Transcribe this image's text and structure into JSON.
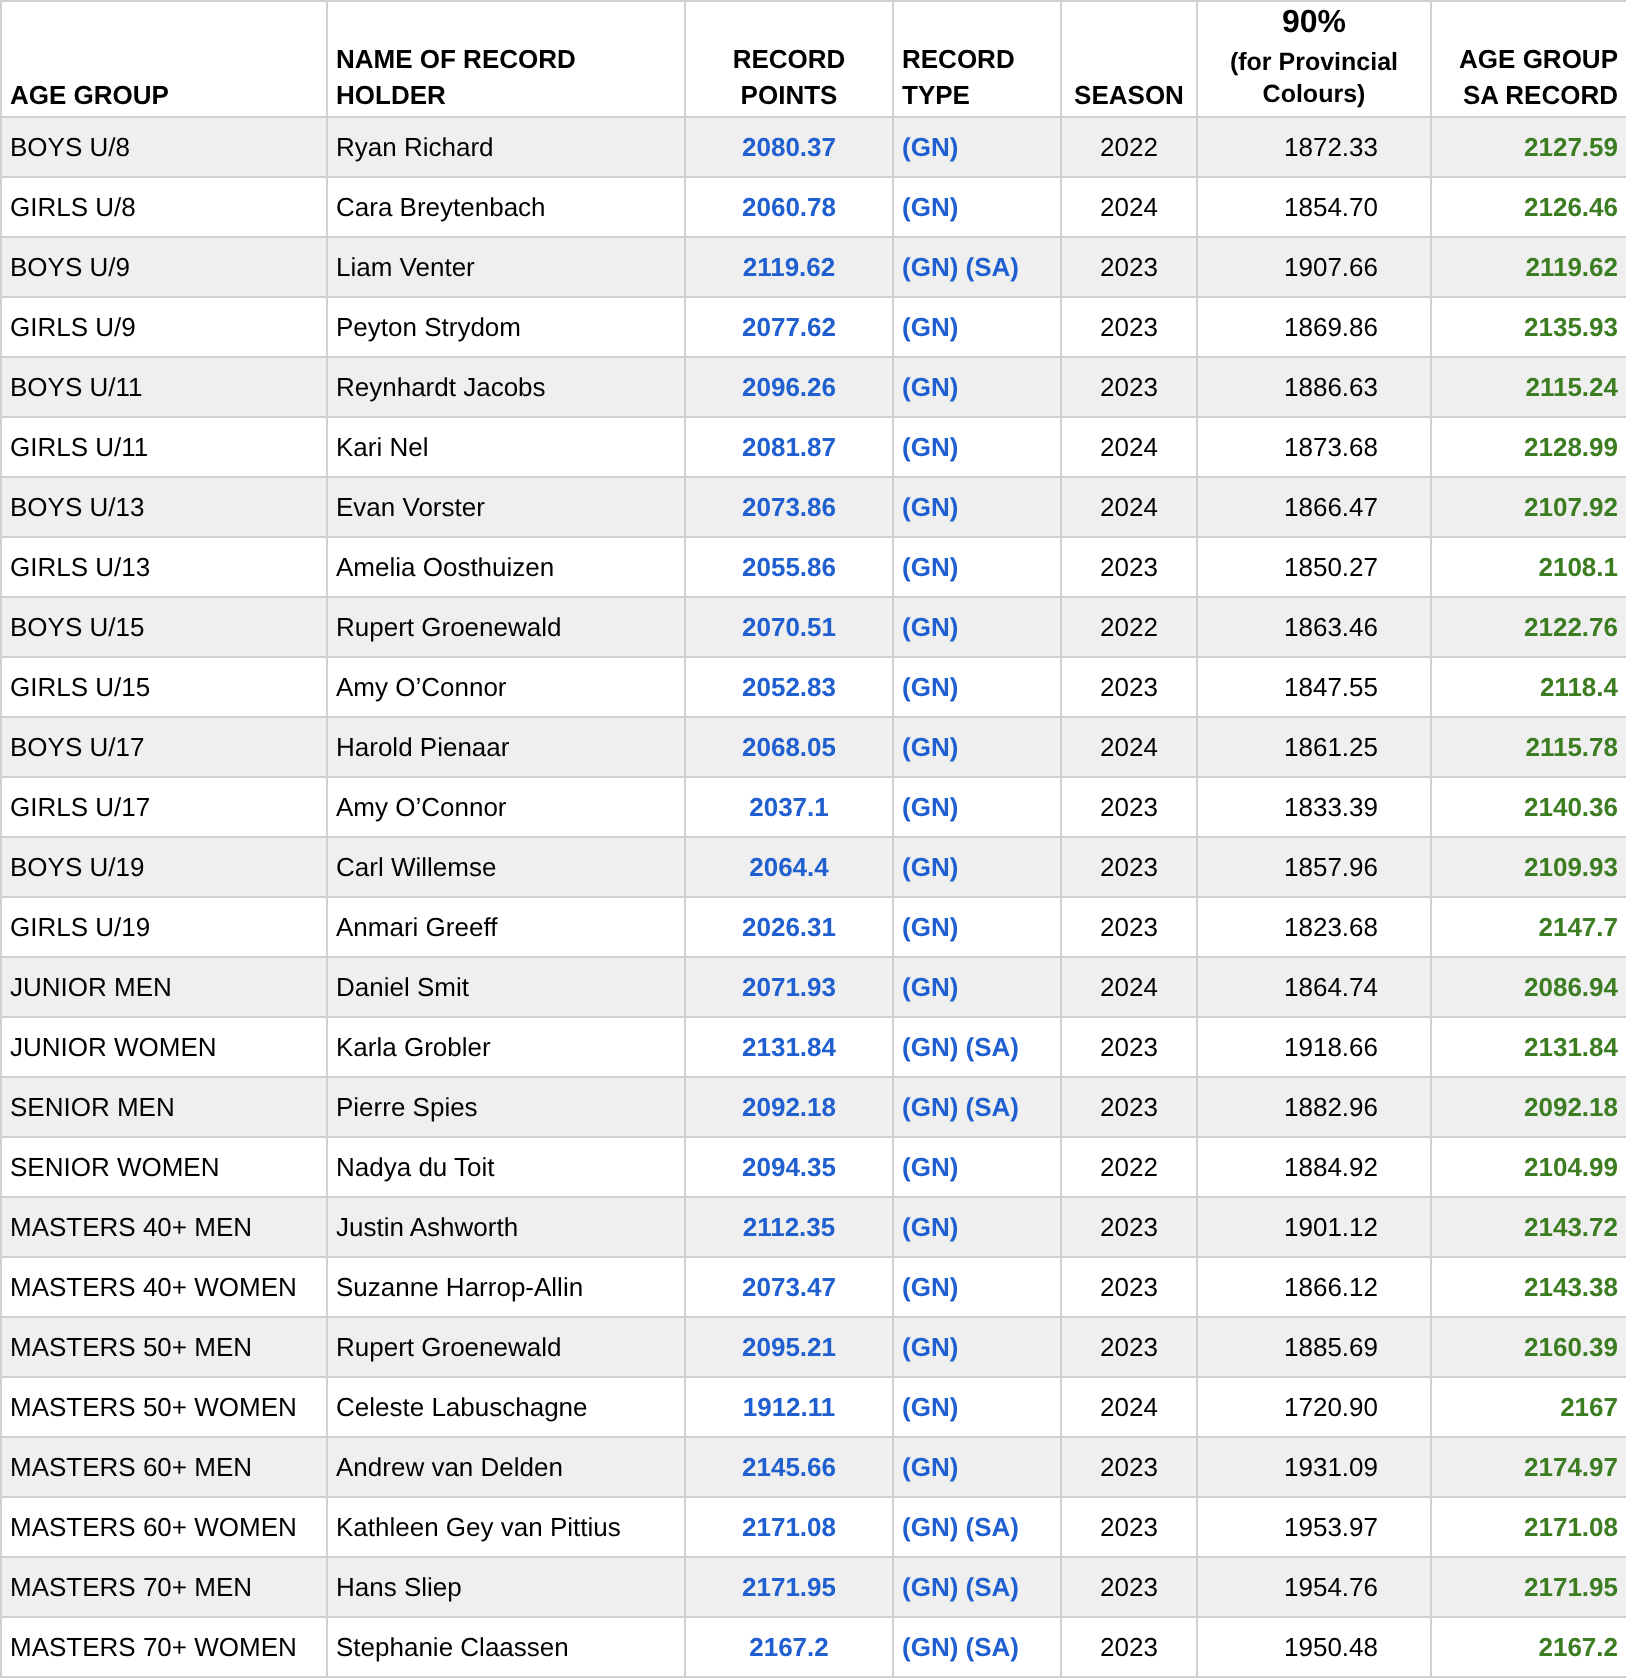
{
  "table": {
    "columns": [
      {
        "label": "AGE GROUP"
      },
      {
        "label": "NAME OF RECORD HOLDER"
      },
      {
        "label": "RECORD POINTS"
      },
      {
        "label": "RECORD TYPE"
      },
      {
        "label": "SEASON"
      },
      {
        "label": "90%",
        "sublabel": "(for Provincial Colours)"
      },
      {
        "label": "AGE GROUP SA RECORD"
      }
    ],
    "rows": [
      [
        "BOYS U/8",
        "Ryan Richard",
        "2080.37",
        "(GN)",
        "2022",
        "1872.33",
        "2127.59"
      ],
      [
        "GIRLS U/8",
        "Cara Breytenbach",
        "2060.78",
        "(GN)",
        "2024",
        "1854.70",
        "2126.46"
      ],
      [
        "BOYS U/9",
        "Liam Venter",
        "2119.62",
        "(GN) (SA)",
        "2023",
        "1907.66",
        "2119.62"
      ],
      [
        "GIRLS U/9",
        "Peyton Strydom",
        "2077.62",
        "(GN)",
        "2023",
        "1869.86",
        "2135.93"
      ],
      [
        "BOYS U/11",
        "Reynhardt Jacobs",
        "2096.26",
        "(GN)",
        "2023",
        "1886.63",
        "2115.24"
      ],
      [
        "GIRLS U/11",
        "Kari Nel",
        "2081.87",
        "(GN)",
        "2024",
        "1873.68",
        "2128.99"
      ],
      [
        "BOYS U/13",
        "Evan Vorster",
        "2073.86",
        "(GN)",
        "2024",
        "1866.47",
        "2107.92"
      ],
      [
        "GIRLS U/13",
        "Amelia Oosthuizen",
        "2055.86",
        "(GN)",
        "2023",
        "1850.27",
        "2108.1"
      ],
      [
        "BOYS U/15",
        "Rupert Groenewald",
        "2070.51",
        "(GN)",
        "2022",
        "1863.46",
        "2122.76"
      ],
      [
        "GIRLS U/15",
        "Amy O’Connor",
        "2052.83",
        "(GN)",
        "2023",
        "1847.55",
        "2118.4"
      ],
      [
        "BOYS U/17",
        "Harold Pienaar",
        "2068.05",
        "(GN)",
        "2024",
        "1861.25",
        "2115.78"
      ],
      [
        "GIRLS U/17",
        "Amy O’Connor",
        "2037.1",
        "(GN)",
        "2023",
        "1833.39",
        "2140.36"
      ],
      [
        "BOYS U/19",
        "Carl Willemse",
        "2064.4",
        "(GN)",
        "2023",
        "1857.96",
        "2109.93"
      ],
      [
        "GIRLS U/19",
        "Anmari Greeff",
        "2026.31",
        "(GN)",
        "2023",
        "1823.68",
        "2147.7"
      ],
      [
        "JUNIOR MEN",
        "Daniel Smit",
        "2071.93",
        "(GN)",
        "2024",
        "1864.74",
        "2086.94"
      ],
      [
        "JUNIOR WOMEN",
        "Karla Grobler",
        "2131.84",
        "(GN) (SA)",
        "2023",
        "1918.66",
        "2131.84"
      ],
      [
        "SENIOR MEN",
        "Pierre Spies",
        "2092.18",
        "(GN) (SA)",
        "2023",
        "1882.96",
        "2092.18"
      ],
      [
        "SENIOR WOMEN",
        "Nadya du Toit",
        "2094.35",
        "(GN)",
        "2022",
        "1884.92",
        "2104.99"
      ],
      [
        "MASTERS 40+ MEN",
        "Justin Ashworth",
        "2112.35",
        "(GN)",
        "2023",
        "1901.12",
        "2143.72"
      ],
      [
        "MASTERS 40+ WOMEN",
        "Suzanne Harrop-Allin",
        "2073.47",
        "(GN)",
        "2023",
        "1866.12",
        "2143.38"
      ],
      [
        "MASTERS 50+ MEN",
        "Rupert Groenewald",
        "2095.21",
        "(GN)",
        "2023",
        "1885.69",
        "2160.39"
      ],
      [
        "MASTERS 50+ WOMEN",
        "Celeste Labuschagne",
        "1912.11",
        "(GN)",
        "2024",
        "1720.90",
        "2167"
      ],
      [
        "MASTERS 60+ MEN",
        "Andrew van Delden",
        "2145.66",
        "(GN)",
        "2023",
        "1931.09",
        "2174.97"
      ],
      [
        "MASTERS 60+ WOMEN",
        "Kathleen Gey van Pittius",
        "2171.08",
        "(GN) (SA)",
        "2023",
        "1953.97",
        "2171.08"
      ],
      [
        "MASTERS 70+ MEN",
        "Hans Sliep",
        "2171.95",
        "(GN) (SA)",
        "2023",
        "1954.76",
        "2171.95"
      ],
      [
        "MASTERS 70+ WOMEN",
        "Stephanie Claassen",
        "2167.2",
        "(GN) (SA)",
        "2023",
        "1950.48",
        "2167.2"
      ]
    ]
  }
}
